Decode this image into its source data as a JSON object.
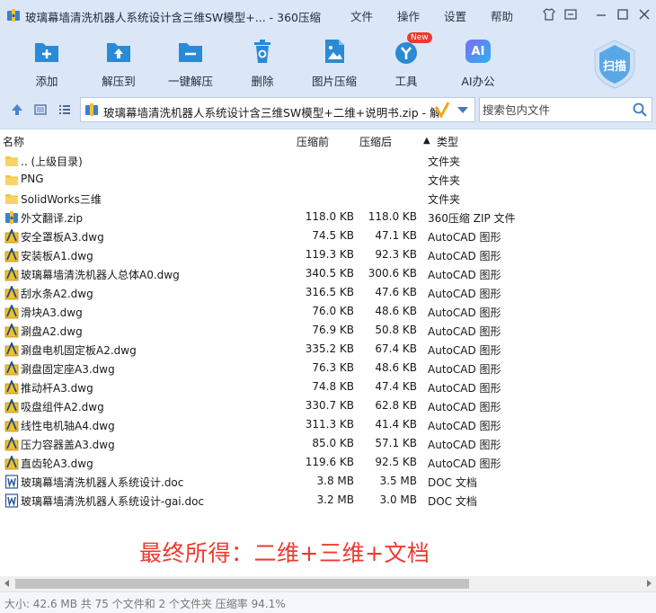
{
  "window": {
    "title": "玻璃幕墙清洗机器人系统设计含三维SW模型+... - 360压缩",
    "menu": [
      "文件",
      "操作",
      "设置",
      "帮助"
    ]
  },
  "toolbar": {
    "buttons": [
      {
        "label": "添加",
        "icon": "add-archive-icon"
      },
      {
        "label": "解压到",
        "icon": "extract-to-icon"
      },
      {
        "label": "一键解压",
        "icon": "one-click-extract-icon"
      },
      {
        "label": "删除",
        "icon": "delete-icon"
      },
      {
        "label": "图片压缩",
        "icon": "image-compress-icon"
      },
      {
        "label": "工具",
        "icon": "tools-icon",
        "badge": "New"
      },
      {
        "label": "AI办公",
        "icon": "ai-office-icon",
        "glyph": "AI"
      }
    ],
    "scan_label": "扫描"
  },
  "address": {
    "path": "玻璃幕墙清洗机器人系统设计含三维SW模型+二维+说明书.zip - 解包",
    "search_placeholder": "搜索包内文件"
  },
  "columns": {
    "name": "名称",
    "size": "压缩前",
    "packed": "压缩后",
    "type": "类型",
    "sort_indicator": "▲"
  },
  "files": [
    {
      "name": ".. (上级目录)",
      "size": "",
      "packed": "",
      "type": "文件夹",
      "kind": "folder"
    },
    {
      "name": "PNG",
      "size": "",
      "packed": "",
      "type": "文件夹",
      "kind": "folder"
    },
    {
      "name": "SolidWorks三维",
      "size": "",
      "packed": "",
      "type": "文件夹",
      "kind": "folder"
    },
    {
      "name": "外文翻译.zip",
      "size": "118.0 KB",
      "packed": "118.0 KB",
      "type": "360压缩 ZIP 文件",
      "kind": "zip"
    },
    {
      "name": "安全罩板A3.dwg",
      "size": "74.5 KB",
      "packed": "47.1 KB",
      "type": "AutoCAD 图形",
      "kind": "dwg"
    },
    {
      "name": "安装板A1.dwg",
      "size": "119.3 KB",
      "packed": "92.3 KB",
      "type": "AutoCAD 图形",
      "kind": "dwg"
    },
    {
      "name": "玻璃幕墙清洗机器人总体A0.dwg",
      "size": "340.5 KB",
      "packed": "300.6 KB",
      "type": "AutoCAD 图形",
      "kind": "dwg"
    },
    {
      "name": "刮水条A2.dwg",
      "size": "316.5 KB",
      "packed": "47.6 KB",
      "type": "AutoCAD 图形",
      "kind": "dwg"
    },
    {
      "name": "滑块A3.dwg",
      "size": "76.0 KB",
      "packed": "48.6 KB",
      "type": "AutoCAD 图形",
      "kind": "dwg"
    },
    {
      "name": "涮盘A2.dwg",
      "size": "76.9 KB",
      "packed": "50.8 KB",
      "type": "AutoCAD 图形",
      "kind": "dwg"
    },
    {
      "name": "涮盘电机固定板A2.dwg",
      "size": "335.2 KB",
      "packed": "67.4 KB",
      "type": "AutoCAD 图形",
      "kind": "dwg"
    },
    {
      "name": "涮盘固定座A3.dwg",
      "size": "76.3 KB",
      "packed": "48.6 KB",
      "type": "AutoCAD 图形",
      "kind": "dwg"
    },
    {
      "name": "推动杆A3.dwg",
      "size": "74.8 KB",
      "packed": "47.4 KB",
      "type": "AutoCAD 图形",
      "kind": "dwg"
    },
    {
      "name": "吸盘组件A2.dwg",
      "size": "330.7 KB",
      "packed": "62.8 KB",
      "type": "AutoCAD 图形",
      "kind": "dwg"
    },
    {
      "name": "线性电机轴A4.dwg",
      "size": "311.3 KB",
      "packed": "41.4 KB",
      "type": "AutoCAD 图形",
      "kind": "dwg"
    },
    {
      "name": "压力容器盖A3.dwg",
      "size": "85.0 KB",
      "packed": "57.1 KB",
      "type": "AutoCAD 图形",
      "kind": "dwg"
    },
    {
      "name": "直齿轮A3.dwg",
      "size": "119.6 KB",
      "packed": "92.5 KB",
      "type": "AutoCAD 图形",
      "kind": "dwg"
    },
    {
      "name": "玻璃幕墙清洗机器人系统设计.doc",
      "size": "3.8 MB",
      "packed": "3.5 MB",
      "type": "DOC 文档",
      "kind": "doc"
    },
    {
      "name": "玻璃幕墙清洗机器人系统设计-gai.doc",
      "size": "3.2 MB",
      "packed": "3.0 MB",
      "type": "DOC 文档",
      "kind": "doc"
    }
  ],
  "promo_text": "最终所得：二维+三维+文档",
  "status": "大小: 42.6 MB 共 75 个文件和 2 个文件夹 压缩率 94.1%",
  "colors": {
    "chrome": "#dbe7f7",
    "accent": "#2a8ad6",
    "promo": "#ee3a2f",
    "folder": "#f5c542",
    "badge": "#ee3a2f"
  }
}
